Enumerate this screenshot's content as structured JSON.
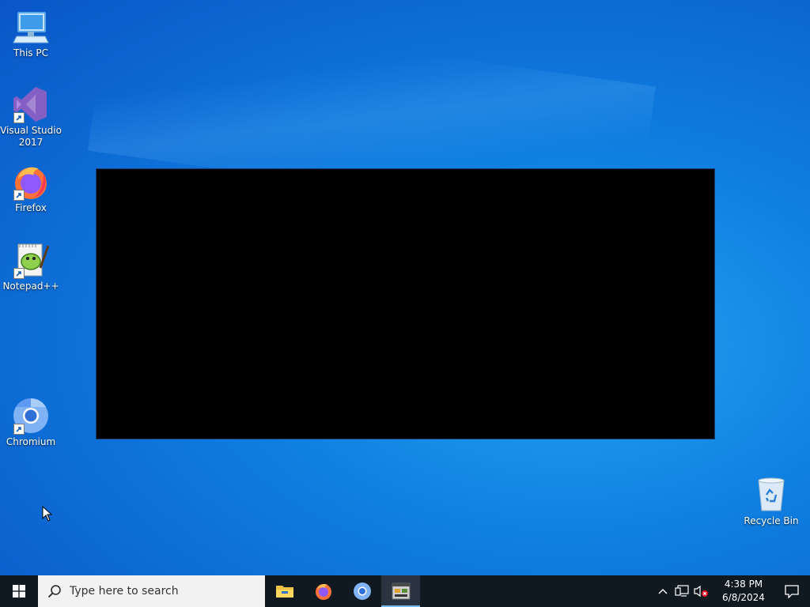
{
  "desktop": {
    "icons": [
      {
        "label": "This PC",
        "icon": "this-pc-icon"
      },
      {
        "label": "Visual Studio 2017",
        "icon": "visual-studio-icon"
      },
      {
        "label": "Firefox",
        "icon": "firefox-icon"
      },
      {
        "label": "Notepad++",
        "icon": "notepad-plus-plus-icon"
      },
      {
        "label": "Chromium",
        "icon": "chromium-icon"
      },
      {
        "label": "Recycle Bin",
        "icon": "recycle-bin-icon"
      }
    ]
  },
  "taskbar": {
    "search_placeholder": "Type here to search",
    "pinned": [
      {
        "icon": "file-explorer-icon",
        "active": false
      },
      {
        "icon": "firefox-icon",
        "active": false
      },
      {
        "icon": "chromium-icon",
        "active": false
      },
      {
        "icon": "app-window-icon",
        "active": true
      }
    ],
    "clock": {
      "time": "4:38 PM",
      "date": "6/8/2024"
    }
  },
  "colors": {
    "desktop_blue": "#0f7fe0",
    "taskbar_bg": "#101820",
    "active_underline": "#76b9ed"
  }
}
